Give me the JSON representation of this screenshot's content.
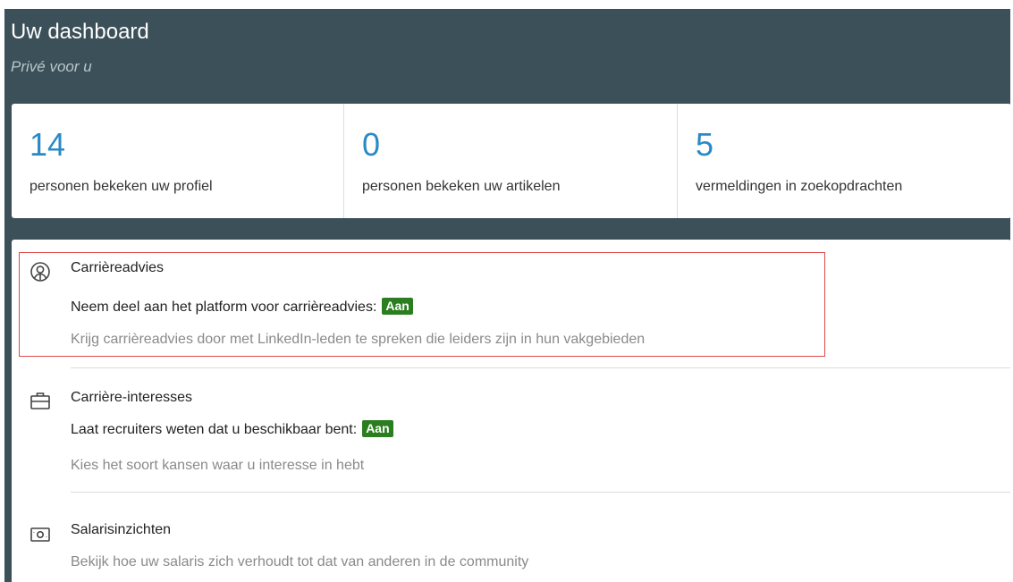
{
  "header": {
    "title": "Uw dashboard",
    "subtitle": "Privé voor u"
  },
  "stats": [
    {
      "value": "14",
      "label": "personen bekeken uw profiel"
    },
    {
      "value": "0",
      "label": "personen bekeken uw artikelen"
    },
    {
      "value": "5",
      "label": "vermeldingen in zoekopdrachten"
    }
  ],
  "items": [
    {
      "icon": "career-advice-icon",
      "title": "Carrièreadvies",
      "line": "Neem deel aan het platform voor carrièreadvies:",
      "badge": "Aan",
      "description": "Krijg carrièreadvies door met LinkedIn-leden te spreken die leiders zijn in hun vakgebieden"
    },
    {
      "icon": "briefcase-icon",
      "title": "Carrière-interesses",
      "line": "Laat recruiters weten dat u beschikbaar bent:",
      "badge": "Aan",
      "description": "Kies het soort kansen waar u interesse in hebt"
    },
    {
      "icon": "money-icon",
      "title": "Salarisinzichten",
      "description": "Bekijk hoe uw salaris zich verhoudt tot dat van anderen in de community"
    }
  ],
  "colors": {
    "header_bg": "#3c5059",
    "stat_value": "#2a8ac6",
    "badge_bg": "#2b7e1f",
    "highlight_border": "#e04848"
  }
}
